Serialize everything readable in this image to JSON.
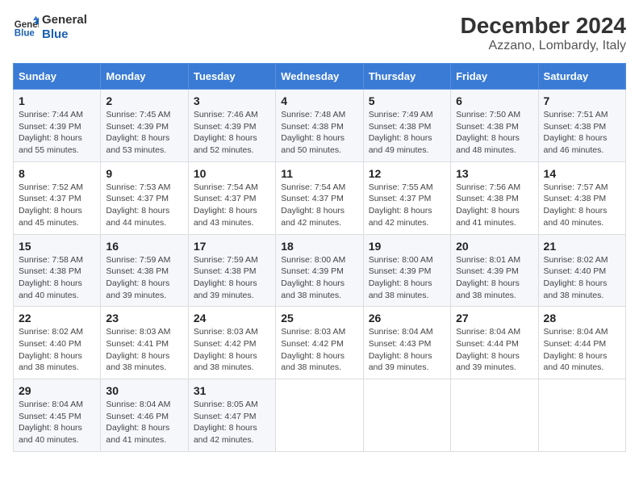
{
  "logo": {
    "text_general": "General",
    "text_blue": "Blue"
  },
  "title": "December 2024",
  "subtitle": "Azzano, Lombardy, Italy",
  "headers": [
    "Sunday",
    "Monday",
    "Tuesday",
    "Wednesday",
    "Thursday",
    "Friday",
    "Saturday"
  ],
  "weeks": [
    [
      {
        "day": "1",
        "sunrise": "7:44 AM",
        "sunset": "4:39 PM",
        "daylight": "8 hours and 55 minutes."
      },
      {
        "day": "2",
        "sunrise": "7:45 AM",
        "sunset": "4:39 PM",
        "daylight": "8 hours and 53 minutes."
      },
      {
        "day": "3",
        "sunrise": "7:46 AM",
        "sunset": "4:39 PM",
        "daylight": "8 hours and 52 minutes."
      },
      {
        "day": "4",
        "sunrise": "7:48 AM",
        "sunset": "4:38 PM",
        "daylight": "8 hours and 50 minutes."
      },
      {
        "day": "5",
        "sunrise": "7:49 AM",
        "sunset": "4:38 PM",
        "daylight": "8 hours and 49 minutes."
      },
      {
        "day": "6",
        "sunrise": "7:50 AM",
        "sunset": "4:38 PM",
        "daylight": "8 hours and 48 minutes."
      },
      {
        "day": "7",
        "sunrise": "7:51 AM",
        "sunset": "4:38 PM",
        "daylight": "8 hours and 46 minutes."
      }
    ],
    [
      {
        "day": "8",
        "sunrise": "7:52 AM",
        "sunset": "4:37 PM",
        "daylight": "8 hours and 45 minutes."
      },
      {
        "day": "9",
        "sunrise": "7:53 AM",
        "sunset": "4:37 PM",
        "daylight": "8 hours and 44 minutes."
      },
      {
        "day": "10",
        "sunrise": "7:54 AM",
        "sunset": "4:37 PM",
        "daylight": "8 hours and 43 minutes."
      },
      {
        "day": "11",
        "sunrise": "7:54 AM",
        "sunset": "4:37 PM",
        "daylight": "8 hours and 42 minutes."
      },
      {
        "day": "12",
        "sunrise": "7:55 AM",
        "sunset": "4:37 PM",
        "daylight": "8 hours and 42 minutes."
      },
      {
        "day": "13",
        "sunrise": "7:56 AM",
        "sunset": "4:38 PM",
        "daylight": "8 hours and 41 minutes."
      },
      {
        "day": "14",
        "sunrise": "7:57 AM",
        "sunset": "4:38 PM",
        "daylight": "8 hours and 40 minutes."
      }
    ],
    [
      {
        "day": "15",
        "sunrise": "7:58 AM",
        "sunset": "4:38 PM",
        "daylight": "8 hours and 40 minutes."
      },
      {
        "day": "16",
        "sunrise": "7:59 AM",
        "sunset": "4:38 PM",
        "daylight": "8 hours and 39 minutes."
      },
      {
        "day": "17",
        "sunrise": "7:59 AM",
        "sunset": "4:38 PM",
        "daylight": "8 hours and 39 minutes."
      },
      {
        "day": "18",
        "sunrise": "8:00 AM",
        "sunset": "4:39 PM",
        "daylight": "8 hours and 38 minutes."
      },
      {
        "day": "19",
        "sunrise": "8:00 AM",
        "sunset": "4:39 PM",
        "daylight": "8 hours and 38 minutes."
      },
      {
        "day": "20",
        "sunrise": "8:01 AM",
        "sunset": "4:39 PM",
        "daylight": "8 hours and 38 minutes."
      },
      {
        "day": "21",
        "sunrise": "8:02 AM",
        "sunset": "4:40 PM",
        "daylight": "8 hours and 38 minutes."
      }
    ],
    [
      {
        "day": "22",
        "sunrise": "8:02 AM",
        "sunset": "4:40 PM",
        "daylight": "8 hours and 38 minutes."
      },
      {
        "day": "23",
        "sunrise": "8:03 AM",
        "sunset": "4:41 PM",
        "daylight": "8 hours and 38 minutes."
      },
      {
        "day": "24",
        "sunrise": "8:03 AM",
        "sunset": "4:42 PM",
        "daylight": "8 hours and 38 minutes."
      },
      {
        "day": "25",
        "sunrise": "8:03 AM",
        "sunset": "4:42 PM",
        "daylight": "8 hours and 38 minutes."
      },
      {
        "day": "26",
        "sunrise": "8:04 AM",
        "sunset": "4:43 PM",
        "daylight": "8 hours and 39 minutes."
      },
      {
        "day": "27",
        "sunrise": "8:04 AM",
        "sunset": "4:44 PM",
        "daylight": "8 hours and 39 minutes."
      },
      {
        "day": "28",
        "sunrise": "8:04 AM",
        "sunset": "4:44 PM",
        "daylight": "8 hours and 40 minutes."
      }
    ],
    [
      {
        "day": "29",
        "sunrise": "8:04 AM",
        "sunset": "4:45 PM",
        "daylight": "8 hours and 40 minutes."
      },
      {
        "day": "30",
        "sunrise": "8:04 AM",
        "sunset": "4:46 PM",
        "daylight": "8 hours and 41 minutes."
      },
      {
        "day": "31",
        "sunrise": "8:05 AM",
        "sunset": "4:47 PM",
        "daylight": "8 hours and 42 minutes."
      },
      null,
      null,
      null,
      null
    ]
  ],
  "labels": {
    "sunrise": "Sunrise:",
    "sunset": "Sunset:",
    "daylight": "Daylight:"
  }
}
